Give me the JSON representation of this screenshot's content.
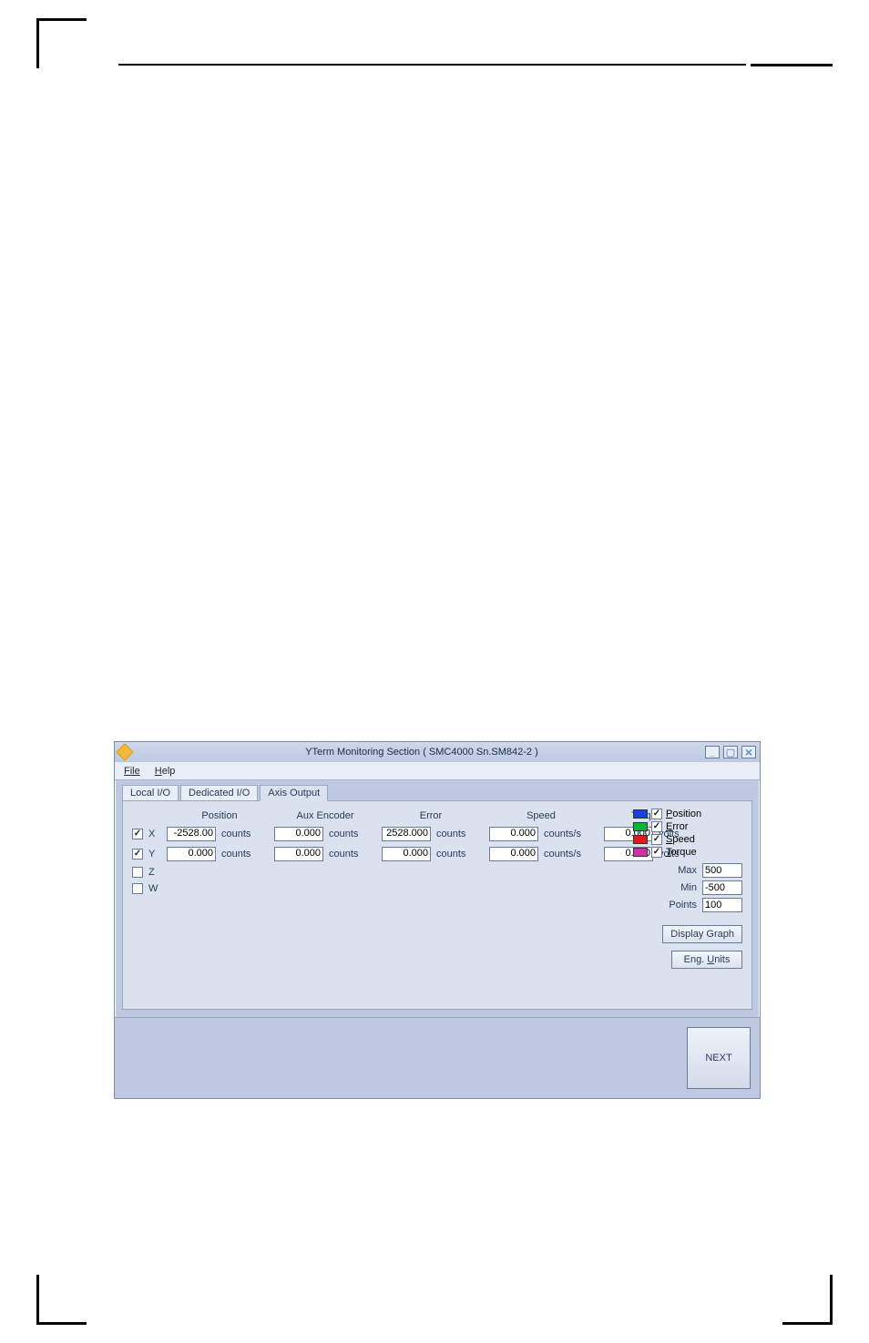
{
  "window": {
    "title": "YTerm Monitoring Section ( SMC4000 Sn.SM842-2 )"
  },
  "menu": {
    "file": "File",
    "help": "Help"
  },
  "tabs": {
    "local": "Local I/O",
    "dedicated": "Dedicated I/O",
    "axis": "Axis Output"
  },
  "headers": {
    "position": "Position",
    "aux": "Aux Encoder",
    "error": "Error",
    "speed": "Speed",
    "torque": "Torque"
  },
  "units": {
    "counts": "counts",
    "counts_s": "counts/s",
    "volts": "volts"
  },
  "axes": {
    "x": {
      "label": "X",
      "checked": true,
      "position": "-2528.00",
      "aux": "0.000",
      "error": "2528.000",
      "speed": "0.000",
      "torque": "0.000"
    },
    "y": {
      "label": "Y",
      "checked": true,
      "position": "0.000",
      "aux": "0.000",
      "error": "0.000",
      "speed": "0.000",
      "torque": "0.000"
    },
    "z": {
      "label": "Z",
      "checked": false
    },
    "w": {
      "label": "W",
      "checked": false
    }
  },
  "legend": {
    "position": "Position",
    "error": "Error",
    "speed": "Speed",
    "torque": "Torque"
  },
  "side": {
    "max_label": "Max",
    "min_label": "Min",
    "points_label": "Points",
    "max": "500",
    "min": "-500",
    "points": "100"
  },
  "buttons": {
    "display_graph": "Display Graph",
    "eng_units": "Eng. Units",
    "next": "NEXT"
  }
}
